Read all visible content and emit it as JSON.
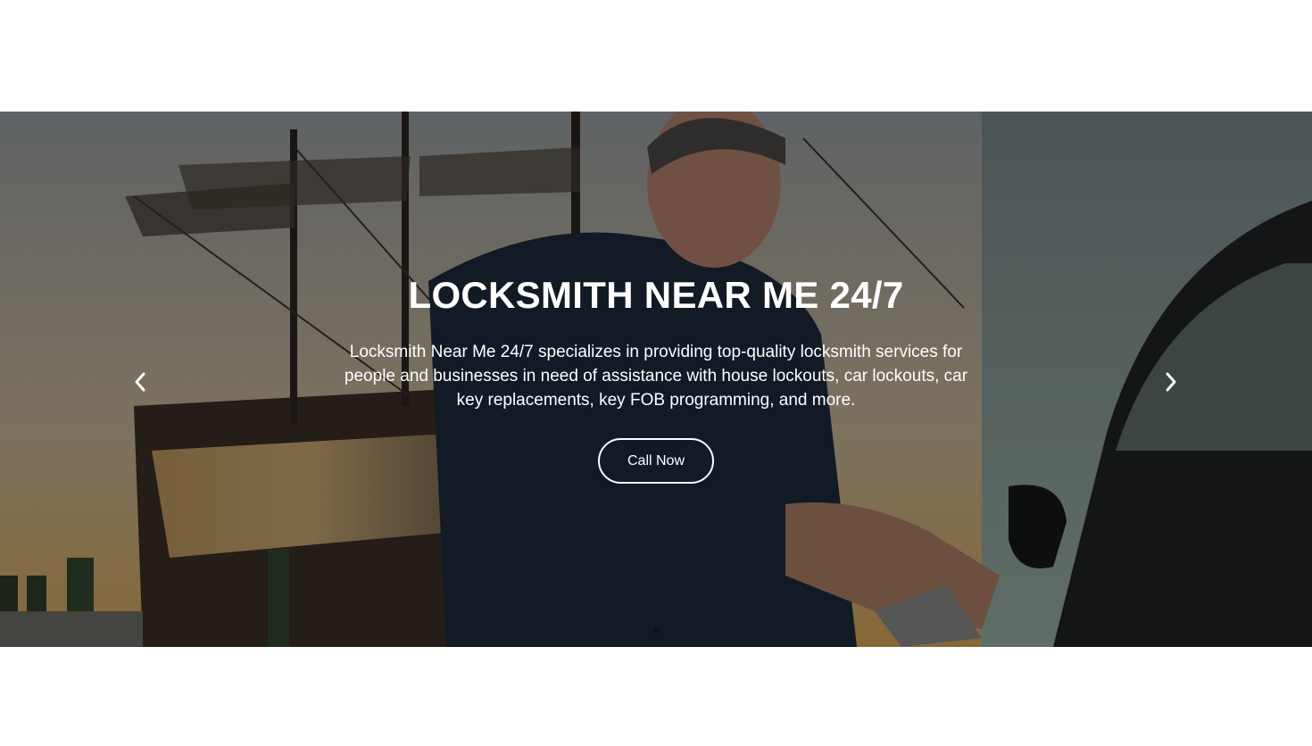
{
  "hero": {
    "title": "LOCKSMITH NEAR ME 24/7",
    "description": "Locksmith Near Me 24/7 specializes in providing top-quality locksmith services for people and businesses in need of assistance with house lockouts, car lockouts, car key replacements, key FOB programming, and more.",
    "cta_label": "Call Now",
    "background_image": "locksmith-at-car-door-with-ship",
    "prev_icon": "chevron-left-icon",
    "next_icon": "chevron-right-icon",
    "slide_indicators": 1,
    "active_indicator": 1
  },
  "colors": {
    "text": "#ffffff",
    "page_background": "#ffffff",
    "overlay": "rgba(0,0,0,0.38)",
    "indicator": "#111111"
  }
}
